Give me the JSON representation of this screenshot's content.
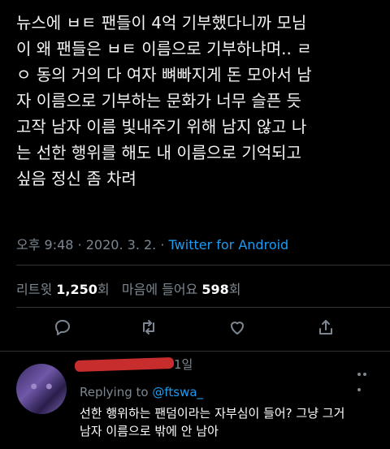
{
  "tweet": {
    "lines": [
      "뉴스에 ㅂㅌ 팬들이 4억 기부했다니까 모님",
      "이 왜 팬들은 ㅂㅌ 이름으로 기부하냐며.. ㄹ",
      "ㅇ 동의 거의 다 여자 뼈빠지게 돈 모아서 남",
      "자 이름으로 기부하는 문화가 너무 슬픈 듯",
      "고작 남자 이름 빛내주기 위해 남지 않고 나",
      "는 선한 행위를 해도 내 이름으로 기억되고",
      "싶음 정신 좀 차려"
    ],
    "time": "오후 9:48",
    "dot": "·",
    "date": "2020. 3. 2.",
    "source": "Twitter for Android"
  },
  "stats": {
    "retweets_label": "리트윗",
    "retweets_count": "1,250",
    "retweets_unit": "회",
    "likes_label": "마음에 들어요",
    "likes_count": "598",
    "likes_unit": "회"
  },
  "actions": {
    "reply_icon": "reply-icon",
    "retweet_icon": "retweet-icon",
    "like_icon": "heart-icon",
    "share_icon": "share-icon"
  },
  "reply": {
    "time_fragment": "1일",
    "replying_prefix": "Replying to",
    "replying_handle": "@ftswa_",
    "lines": [
      "선한 행위하는 팬덤이라는 자부심이 들어? 그냥 그거",
      "남자 이름으로 밖에 안 남아"
    ]
  },
  "colors": {
    "background": "#000000",
    "accent": "#1d9bf0",
    "muted": "#7c8791",
    "redaction": "#c82d2d"
  }
}
